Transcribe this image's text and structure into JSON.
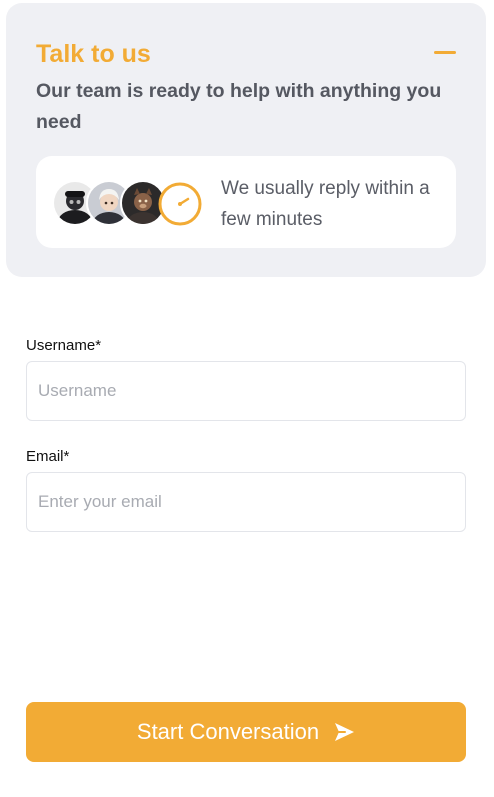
{
  "header": {
    "title": "Talk to us",
    "subtitle": "Our team is ready to help with anything you need",
    "minimize_icon": "minus-icon",
    "reply_note": "We usually reply within a few minutes",
    "avatars": [
      "avatar-1",
      "avatar-2",
      "avatar-3"
    ],
    "clock_icon": "clock-icon"
  },
  "form": {
    "username": {
      "label": "Username*",
      "placeholder": "Username",
      "value": ""
    },
    "email": {
      "label": "Email*",
      "placeholder": "Enter your email",
      "value": ""
    }
  },
  "submit": {
    "label": "Start Conversation",
    "icon": "send-icon"
  },
  "colors": {
    "accent": "#f2ab35",
    "card_bg": "#eff0f4",
    "text_muted": "#555861"
  }
}
